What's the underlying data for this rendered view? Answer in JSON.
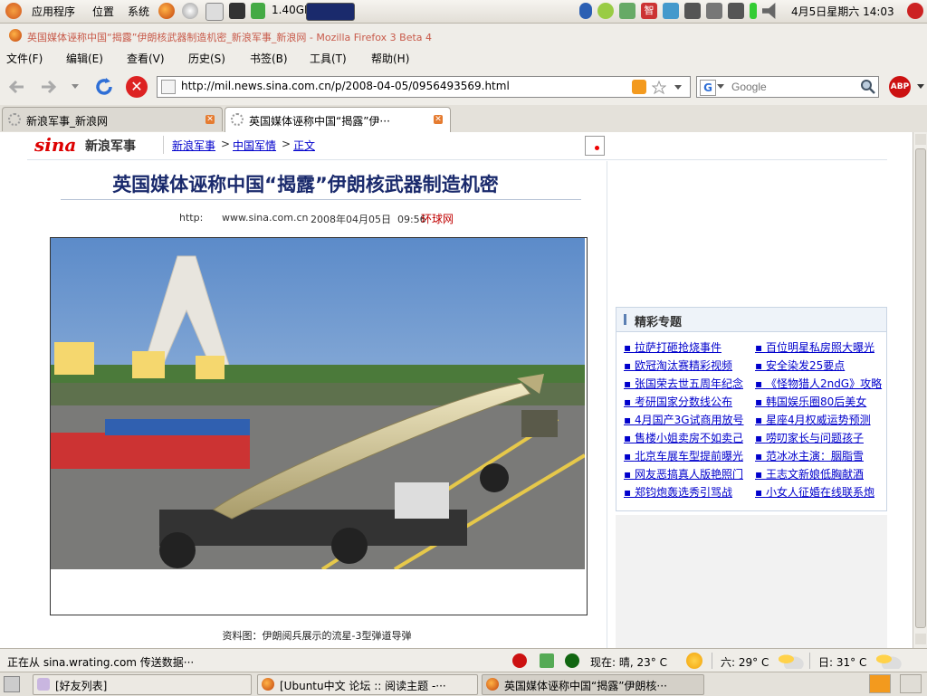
{
  "top_panel": {
    "apps_label": "应用程序",
    "places_label": "位置",
    "system_label": "系统",
    "cpu_freq": "1.40GHz",
    "datetime": "4月5日星期六 14:03"
  },
  "window": {
    "title": "英国媒体诬称中国“揭露”伊朗核武器制造机密_新浪军事_新浪网 - Mozilla Firefox 3 Beta 4"
  },
  "menu": [
    "文件(F)",
    "编辑(E)",
    "查看(V)",
    "历史(S)",
    "书签(B)",
    "工具(T)",
    "帮助(H)"
  ],
  "nav": {
    "url": "http://mil.news.sina.com.cn/p/2008-04-05/0956493569.html",
    "search_placeholder": "Google"
  },
  "tabs": [
    {
      "label": "新浪军事_新浪网"
    },
    {
      "label": "英国媒体诬称中国“揭露”伊···"
    }
  ],
  "page": {
    "logo": "sina",
    "section": "新浪军事",
    "breadcrumb": [
      "新浪军事",
      "中国军情",
      "正文"
    ],
    "article_title": "英国媒体诬称中国“揭露”伊朗核武器制造机密",
    "meta_http": "http:",
    "meta_site": "www.sina.com.cn",
    "meta_date": "2008年04月05日  09:56",
    "meta_source": "环球网",
    "caption": "资料图：伊朗阅兵展示的流星-3型弹道导弹",
    "topics_title": "精彩专题",
    "topics_left": [
      "拉萨打砸抢烧事件",
      "欧冠淘汰赛精彩视频",
      "张国荣去世五周年纪念",
      "考研国家分数线公布",
      "4月国产3G试商用放号",
      "售楼小姐卖房不如卖己",
      "北京车展车型提前曝光",
      "网友恶搞真人版艳照门",
      "郑钧炮轰选秀引骂战"
    ],
    "topics_right": [
      "百位明星私房照大曝光",
      "安全染发25要点",
      "《怪物猎人2ndG》攻略",
      "韩国娱乐圈80后美女",
      "星座4月权威运势预测",
      "唠叨家长与问题孩子",
      "范冰冰主演：胭脂雪",
      "王志文新娘低胸献酒",
      "小女人征婚在线联系炮"
    ]
  },
  "status": {
    "text": "正在从 sina.wrating.com 传送数据···",
    "weather_now": "现在: 晴, 23° C",
    "weather_sat": "六: 29° C",
    "weather_sun": "日: 31° C"
  },
  "taskbar": {
    "items": [
      "[好友列表]",
      "[Ubuntu中文 论坛 :: 阅读主题 -···",
      "英国媒体诬称中国“揭露”伊朗核···"
    ]
  },
  "colors": {
    "title_red": "#c85a4a",
    "link_blue": "#0000cc",
    "heading_navy": "#1a2a6c",
    "source_red": "#c00000",
    "panel_bg": "#efede8"
  }
}
